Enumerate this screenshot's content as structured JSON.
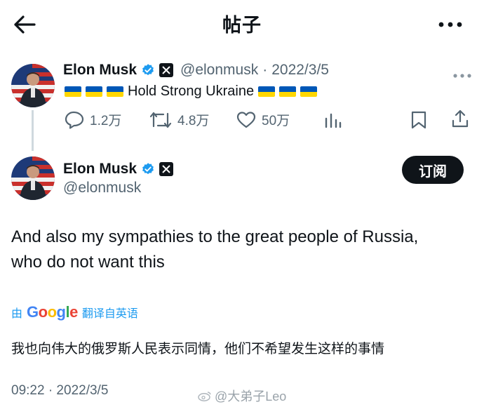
{
  "header": {
    "title": "帖子"
  },
  "parent_tweet": {
    "display_name": "Elon Musk",
    "handle": "@elonmusk",
    "separator": "·",
    "date": "2022/3/5",
    "text": "Hold Strong Ukraine",
    "flags_before": 3,
    "flags_after": 3,
    "actions": {
      "replies": "1.2万",
      "retweets": "4.8万",
      "likes": "50万"
    }
  },
  "main_tweet": {
    "display_name": "Elon Musk",
    "handle": "@elonmusk",
    "subscribe_label": "订阅",
    "text_line1": "And also my sympathies to the great people of Russia,",
    "text_line2": "who do not want this",
    "translate_prefix": "由",
    "translate_brand": "Google",
    "translate_suffix": "翻译自英语",
    "translated_text": "我也向伟大的俄罗斯人民表示同情，他们不希望发生这样的事情",
    "timestamp": "09:22 · 2022/3/5"
  },
  "watermark": {
    "text": "@大弟子Leo"
  },
  "colors": {
    "accent": "#1d9bf0",
    "text": "#0f1419",
    "secondary": "#536471",
    "ukraine_blue": "#0057b7",
    "ukraine_yellow": "#ffd700"
  }
}
